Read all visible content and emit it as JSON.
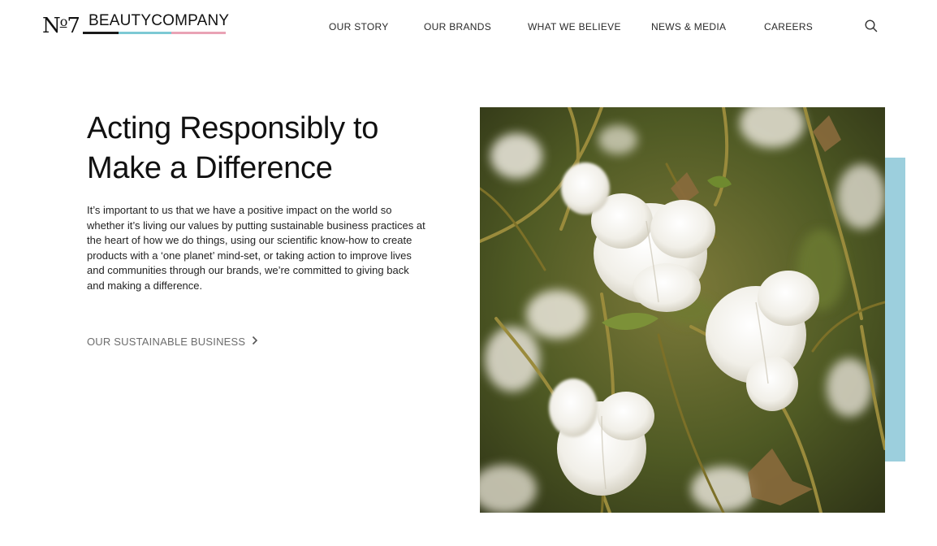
{
  "brand": {
    "mark": "N",
    "mark_o": "o",
    "mark_digit": "7",
    "wordmark": "BEAUTYCOMPANY"
  },
  "nav": {
    "items": [
      {
        "label": "OUR STORY"
      },
      {
        "label": "OUR BRANDS"
      },
      {
        "label": "WHAT WE BELIEVE"
      },
      {
        "label": "NEWS & MEDIA"
      },
      {
        "label": "CAREERS"
      }
    ],
    "search_icon": "search-icon"
  },
  "hero": {
    "title": "Acting Responsibly to Make a Difference",
    "body": "It’s important to us that we have a positive impact on the world so whether it’s living our values by putting sustainable business practices at the heart of how we do things, using our scientific know-how to create products with a ‘one planet’ mind-set, or taking action to improve lives and communities through our brands, we’re committed to giving back and making a difference.",
    "cta_label": "OUR SUSTAINABLE BUSINESS",
    "cta_icon": "chevron-right-icon"
  },
  "colors": {
    "accent_blue": "#9ccfdd",
    "accent_pink": "#e9a3b5",
    "accent_teal": "#7dc9d4",
    "text_dark": "#111111",
    "cta_grey": "#6d6d6d"
  }
}
